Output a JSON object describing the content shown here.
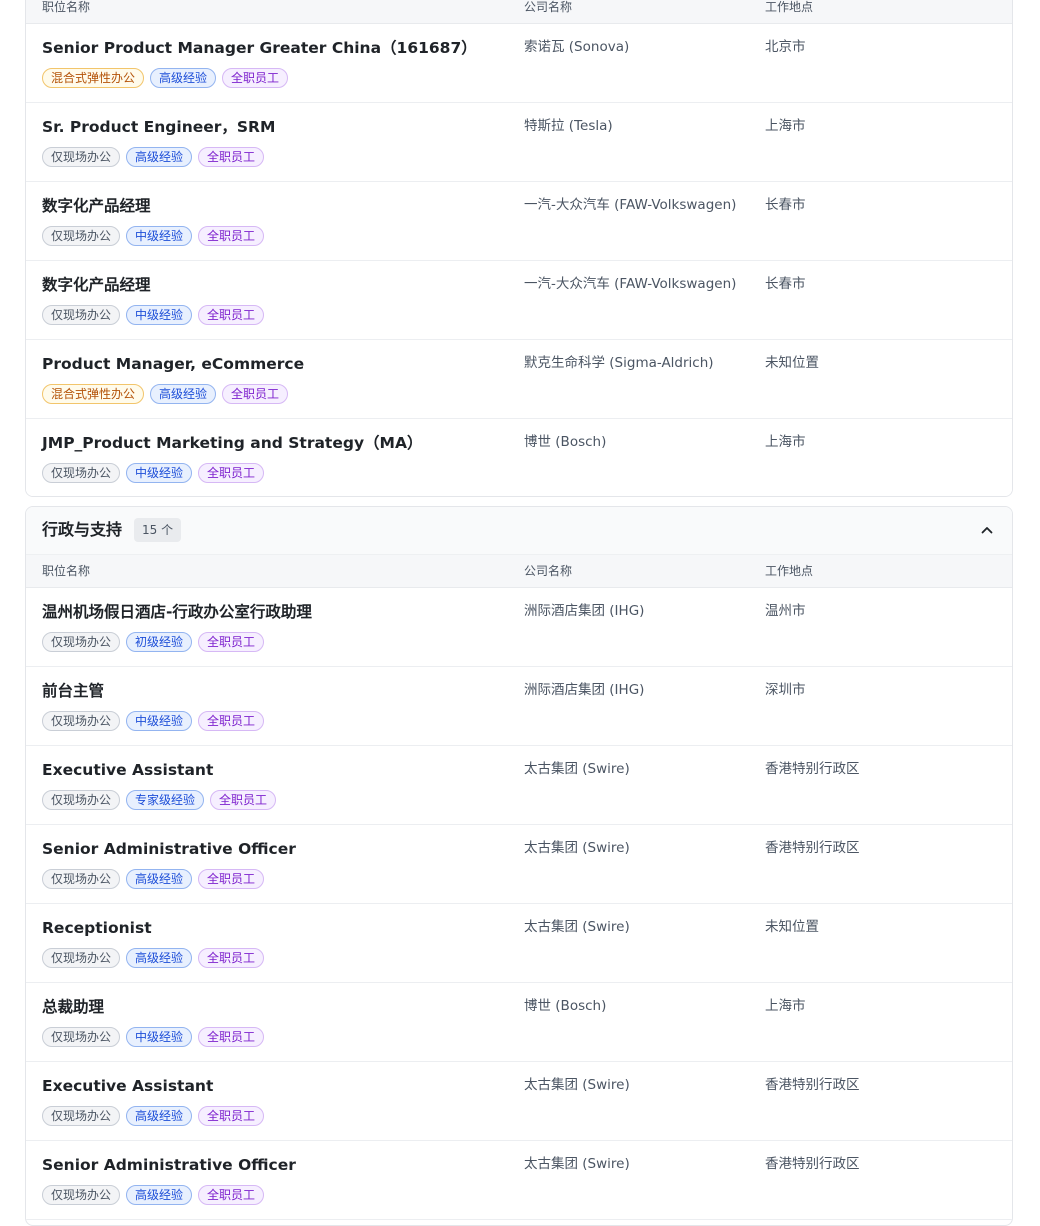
{
  "columns": {
    "title": "职位名称",
    "company": "公司名称",
    "location": "工作地点"
  },
  "groups": [
    {
      "jobs": [
        {
          "title": "Senior Product Manager Greater China（161687）",
          "work_mode": "混合式弹性办公",
          "experience": "高级经验",
          "employment": "全职员工",
          "company": "索诺瓦 (Sonova)",
          "location": "北京市"
        },
        {
          "title": "Sr. Product Engineer，SRM",
          "work_mode": "仅现场办公",
          "experience": "高级经验",
          "employment": "全职员工",
          "company": "特斯拉 (Tesla)",
          "location": "上海市"
        },
        {
          "title": "数字化产品经理",
          "work_mode": "仅现场办公",
          "experience": "中级经验",
          "employment": "全职员工",
          "company": "一汽-大众汽车 (FAW-Volkswagen)",
          "location": "长春市"
        },
        {
          "title": "数字化产品经理",
          "work_mode": "仅现场办公",
          "experience": "中级经验",
          "employment": "全职员工",
          "company": "一汽-大众汽车 (FAW-Volkswagen)",
          "location": "长春市"
        },
        {
          "title": "Product Manager, eCommerce",
          "work_mode": "混合式弹性办公",
          "experience": "高级经验",
          "employment": "全职员工",
          "company": "默克生命科学 (Sigma-Aldrich)",
          "location": "未知位置"
        },
        {
          "title": "JMP_Product Marketing and Strategy（MA）",
          "work_mode": "仅现场办公",
          "experience": "中级经验",
          "employment": "全职员工",
          "company": "博世 (Bosch)",
          "location": "上海市"
        }
      ]
    },
    {
      "name": "行政与支持",
      "count": "15 个",
      "jobs": [
        {
          "title": "温州机场假日酒店-行政办公室行政助理",
          "work_mode": "仅现场办公",
          "experience": "初级经验",
          "employment": "全职员工",
          "company": "洲际酒店集团 (IHG)",
          "location": "温州市"
        },
        {
          "title": "前台主管",
          "work_mode": "仅现场办公",
          "experience": "中级经验",
          "employment": "全职员工",
          "company": "洲际酒店集团 (IHG)",
          "location": "深圳市"
        },
        {
          "title": "Executive Assistant",
          "work_mode": "仅现场办公",
          "experience": "专家级经验",
          "employment": "全职员工",
          "company": "太古集团 (Swire)",
          "location": "香港特别行政区"
        },
        {
          "title": "Senior Administrative Officer",
          "work_mode": "仅现场办公",
          "experience": "高级经验",
          "employment": "全职员工",
          "company": "太古集团 (Swire)",
          "location": "香港特别行政区"
        },
        {
          "title": "Receptionist",
          "work_mode": "仅现场办公",
          "experience": "高级经验",
          "employment": "全职员工",
          "company": "太古集团 (Swire)",
          "location": "未知位置"
        },
        {
          "title": "总裁助理",
          "work_mode": "仅现场办公",
          "experience": "中级经验",
          "employment": "全职员工",
          "company": "博世 (Bosch)",
          "location": "上海市"
        },
        {
          "title": "Executive Assistant",
          "work_mode": "仅现场办公",
          "experience": "高级经验",
          "employment": "全职员工",
          "company": "太古集团 (Swire)",
          "location": "香港特别行政区"
        },
        {
          "title": "Senior Administrative Officer",
          "work_mode": "仅现场办公",
          "experience": "高级经验",
          "employment": "全职员工",
          "company": "太古集团 (Swire)",
          "location": "香港特别行政区"
        }
      ]
    }
  ]
}
